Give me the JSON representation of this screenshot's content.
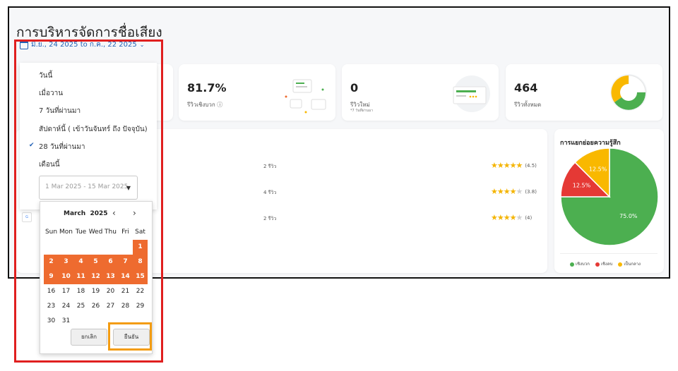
{
  "page": {
    "title": "การบริหารจัดการชื่อเสียง"
  },
  "date_filter": {
    "label": "มิ.ย., 24 2025 to ก.ค., 22 2025"
  },
  "stats": [
    {
      "value": "81.7%",
      "label": "รีวิวเชิงบวก ⓘ"
    },
    {
      "value": "0",
      "label": "รีวิวใหม่",
      "sub": "*7 วันที่ผ่านมา"
    },
    {
      "value": "464",
      "label": "รีวิวทั้งหมด"
    }
  ],
  "review_rows": [
    {
      "count": "2 รีวิว",
      "stars": 4.5,
      "rating": "(4.5)"
    },
    {
      "count": "4 รีวิว",
      "stars": 3.8,
      "rating": "(3.8)"
    },
    {
      "count": "2 รีวิว",
      "stars": 4,
      "rating": "(4)"
    }
  ],
  "sentiment": {
    "title": "การแยกย่อยความรู้สึก",
    "legend": [
      "เชิงบวก",
      "เชิงลบ",
      "เป็นกลาง"
    ],
    "colors": {
      "positive": "#4caf50",
      "negative": "#e53935",
      "neutral": "#f9b800"
    }
  },
  "chart_data": {
    "type": "pie",
    "title": "การแยกย่อยความรู้สึก",
    "categories": [
      "เชิงบวก",
      "เชิงลบ",
      "เป็นกลาง"
    ],
    "values": [
      75.0,
      12.5,
      12.5
    ],
    "data_labels": [
      "75.0%",
      "12.5%",
      "12.5%"
    ],
    "legend_position": "bottom"
  },
  "presets": {
    "items": [
      "วันนี้",
      "เมื่อวาน",
      "7 วันที่ผ่านมา",
      "สัปดาห์นี้ ( เข้าวันจันทร์ ถึง ปัจจุบัน)",
      "28 วันที่ผ่านมา",
      "เดือนนี้"
    ],
    "selected_index": 4
  },
  "range_input": {
    "value": "1 Mar 2025 - 15 Mar 2025"
  },
  "calendar": {
    "month": "March",
    "year": "2025",
    "weekdays": [
      "Sun",
      "Mon",
      "Tue",
      "Wed",
      "Thu",
      "Fri",
      "Sat"
    ],
    "first_weekday": 6,
    "days_in_month": 31,
    "range": [
      1,
      15
    ],
    "cancel_label": "ยกเลิก",
    "confirm_label": "ยืนยัน"
  },
  "icons": {
    "calendar": "calendar-icon",
    "dropdown": "chevron-down-icon",
    "prev": "chevron-left-icon",
    "next": "chevron-right-icon",
    "check": "check-icon"
  },
  "accent": "#ee6b2f"
}
